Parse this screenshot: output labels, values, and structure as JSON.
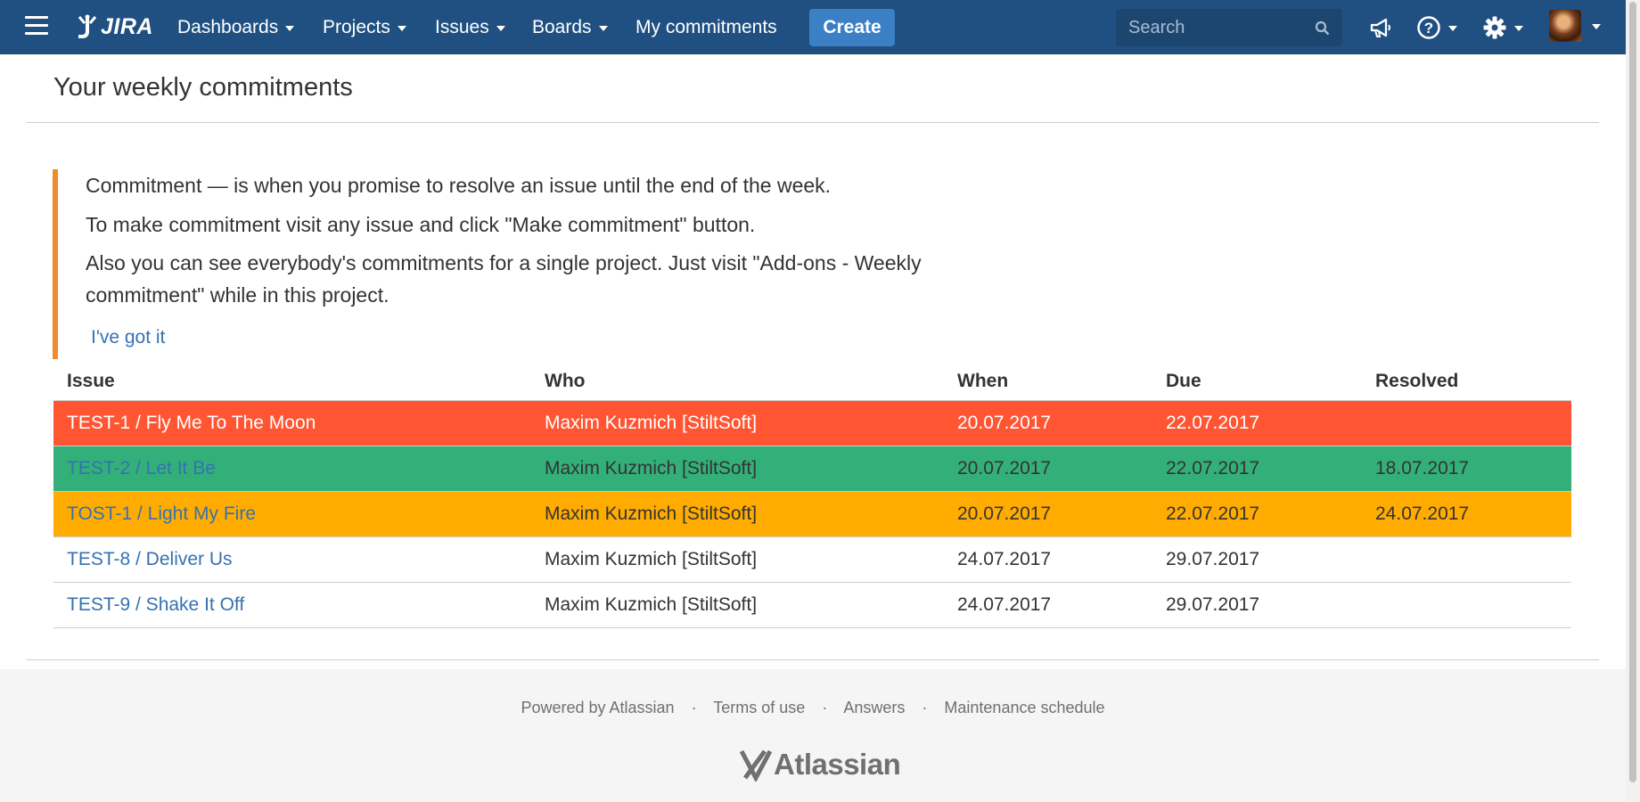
{
  "nav": {
    "logo_text": "JIRA",
    "items": [
      {
        "label": "Dashboards"
      },
      {
        "label": "Projects"
      },
      {
        "label": "Issues"
      },
      {
        "label": "Boards"
      },
      {
        "label": "My commitments"
      }
    ],
    "create_label": "Create",
    "search_placeholder": "Search",
    "icons": [
      "menu-icon",
      "jira-logo-icon",
      "search-icon",
      "megaphone-icon",
      "help-icon",
      "gear-icon",
      "avatar"
    ],
    "bar_color": "#205081",
    "create_color": "#3b7fc4"
  },
  "page": {
    "title": "Your weekly commitments"
  },
  "info": {
    "line1": "Commitment — is when you promise to resolve an issue until the end of the week.",
    "line2": "To make commitment visit any issue and click \"Make commitment\" button.",
    "line3": "Also you can see everybody's commitments for a single project. Just visit \"Add-ons - Weekly commitment\" while in this project.",
    "dismiss_label": "I've got it",
    "accent_color": "#f08c2a"
  },
  "table": {
    "headers": {
      "issue": "Issue",
      "who": "Who",
      "when": "When",
      "due": "Due",
      "resolved": "Resolved"
    },
    "rows": [
      {
        "issue": "TEST-1 / Fly Me To The Moon",
        "who": "Maxim Kuzmich [StiltSoft]",
        "when": "20.07.2017",
        "due": "22.07.2017",
        "resolved": "",
        "status_color": "#ff5533"
      },
      {
        "issue": "TEST-2 / Let It Be",
        "who": "Maxim Kuzmich [StiltSoft]",
        "when": "20.07.2017",
        "due": "22.07.2017",
        "resolved": "18.07.2017",
        "status_color": "#33b07a"
      },
      {
        "issue": "TOST-1 / Light My Fire",
        "who": "Maxim Kuzmich [StiltSoft]",
        "when": "20.07.2017",
        "due": "22.07.2017",
        "resolved": "24.07.2017",
        "status_color": "#ffab00"
      },
      {
        "issue": "TEST-8 / Deliver Us",
        "who": "Maxim Kuzmich [StiltSoft]",
        "when": "24.07.2017",
        "due": "29.07.2017",
        "resolved": ""
      },
      {
        "issue": "TEST-9 / Shake It Off",
        "who": "Maxim Kuzmich [StiltSoft]",
        "when": "24.07.2017",
        "due": "29.07.2017",
        "resolved": ""
      }
    ]
  },
  "footer": {
    "links": [
      "Powered by Atlassian",
      "Terms of use",
      "Answers",
      "Maintenance schedule"
    ],
    "separator": "·",
    "logo_text": "Atlassian"
  }
}
